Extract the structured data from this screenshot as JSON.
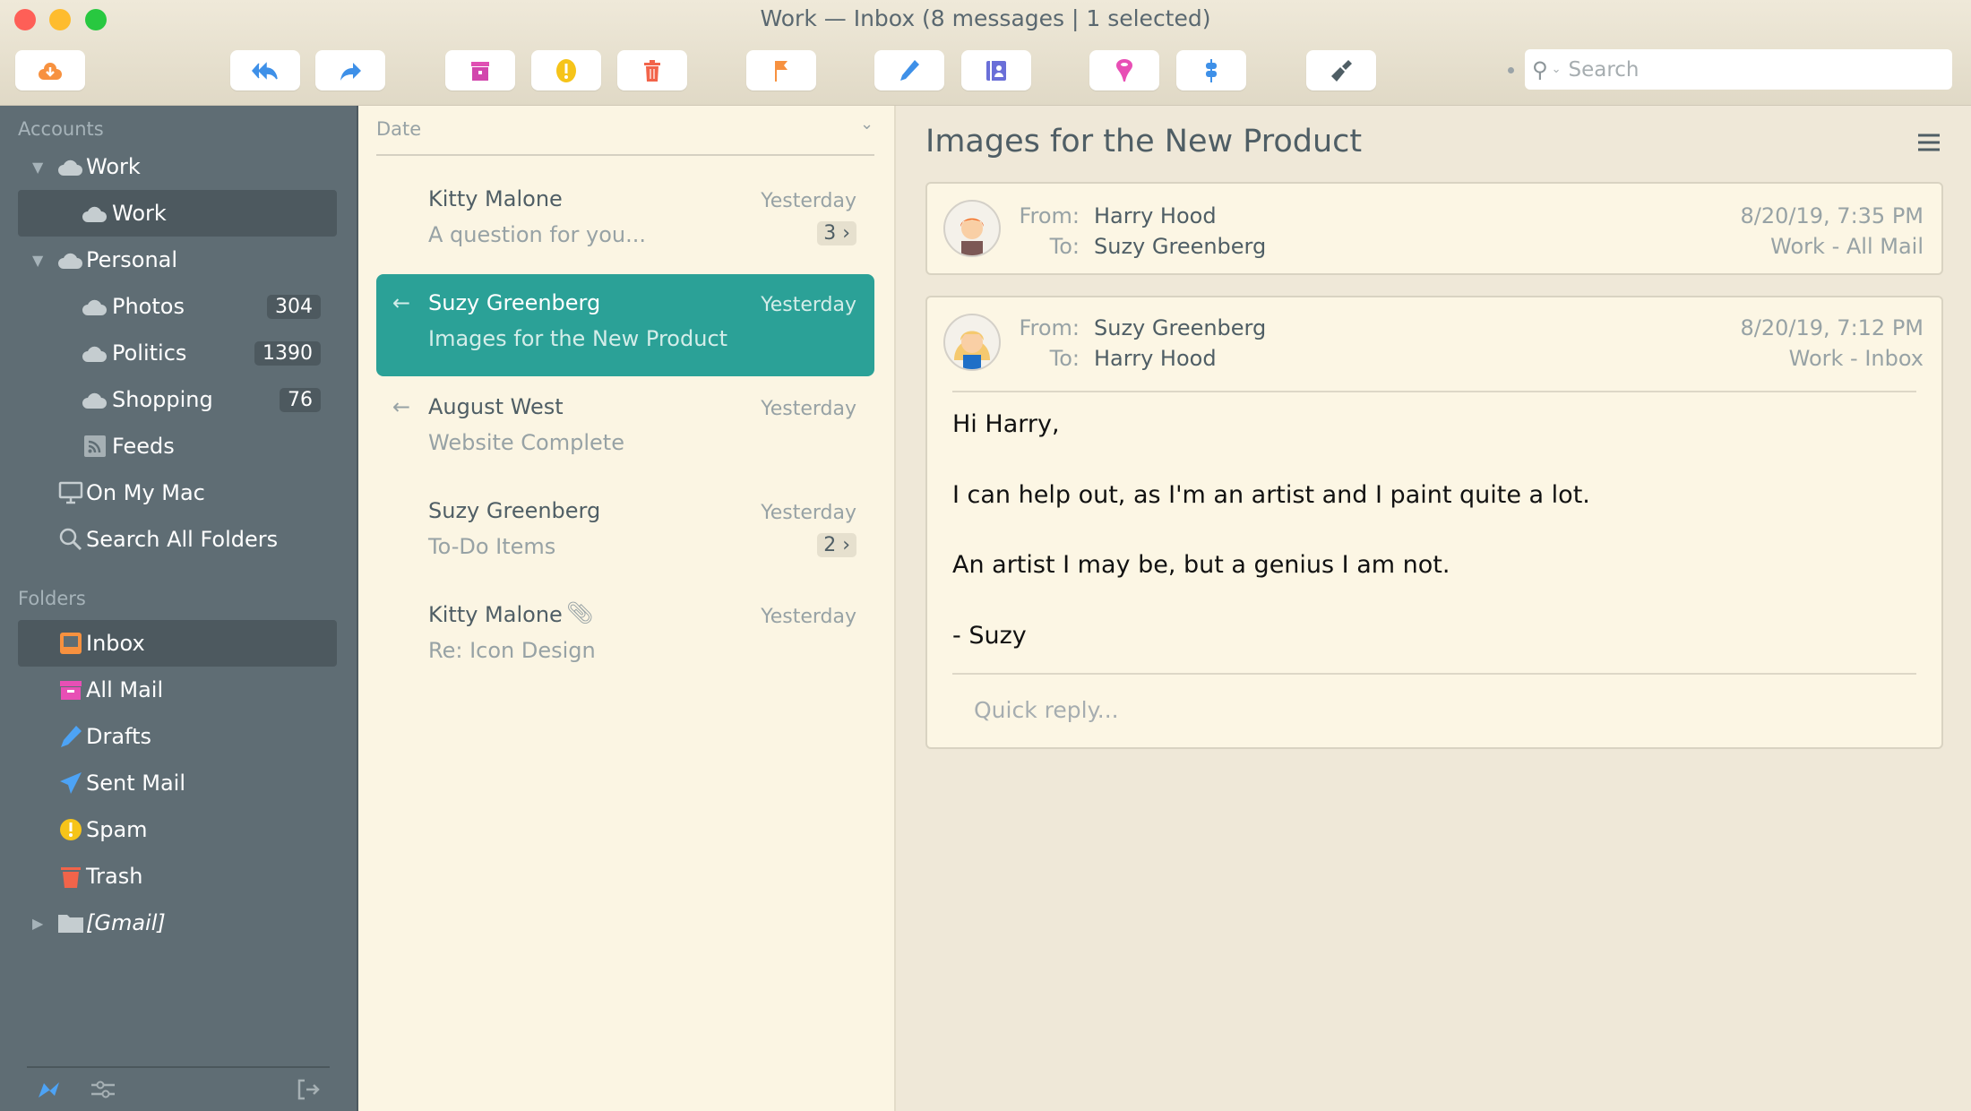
{
  "window": {
    "title": "Work — Inbox (8 messages | 1 selected)"
  },
  "toolbar": {
    "buttons": [
      "get-mail",
      "reply-all",
      "forward",
      "archive",
      "spam",
      "delete",
      "flag",
      "compose",
      "contacts",
      "filter",
      "rules",
      "theme"
    ],
    "search_placeholder": "Search"
  },
  "sidebar": {
    "accounts_header": "Accounts",
    "accounts": [
      {
        "label": "Work",
        "type": "account"
      },
      {
        "label": "Work",
        "type": "sub",
        "selected": true
      },
      {
        "label": "Personal",
        "type": "account"
      },
      {
        "label": "Photos",
        "type": "sub",
        "badge": "304"
      },
      {
        "label": "Politics",
        "type": "sub",
        "badge": "1390"
      },
      {
        "label": "Shopping",
        "type": "sub",
        "badge": "76"
      },
      {
        "label": "Feeds",
        "type": "sub"
      },
      {
        "label": "On My Mac",
        "type": "top"
      },
      {
        "label": "Search All Folders",
        "type": "top"
      }
    ],
    "folders_header": "Folders",
    "folders": [
      {
        "label": "Inbox",
        "selected": true
      },
      {
        "label": "All Mail"
      },
      {
        "label": "Drafts"
      },
      {
        "label": "Sent Mail"
      },
      {
        "label": "Spam"
      },
      {
        "label": "Trash"
      },
      {
        "label": "[Gmail]"
      }
    ]
  },
  "list": {
    "sort_label": "Date",
    "messages": [
      {
        "from": "Kitty Malone",
        "subject": "A question for you...",
        "date": "Yesterday",
        "count": "3 ›"
      },
      {
        "from": "Suzy Greenberg",
        "subject": "Images for the New Product",
        "date": "Yesterday",
        "replied": true,
        "selected": true
      },
      {
        "from": "August West",
        "subject": "Website Complete",
        "date": "Yesterday",
        "replied": true
      },
      {
        "from": "Suzy Greenberg",
        "subject": "To-Do Items",
        "date": "Yesterday",
        "count": "2 ›"
      },
      {
        "from": "Kitty Malone",
        "subject": "Re: Icon Design",
        "date": "Yesterday",
        "attachment": true
      }
    ]
  },
  "reader": {
    "subject": "Images for the New Product",
    "from_label": "From:",
    "to_label": "To:",
    "messages": [
      {
        "from": "Harry Hood",
        "to": "Suzy Greenberg",
        "date": "8/20/19, 7:35 PM",
        "folder": "Work - All Mail"
      },
      {
        "from": "Suzy Greenberg",
        "to": "Harry Hood",
        "date": "8/20/19, 7:12 PM",
        "folder": "Work - Inbox",
        "body": [
          "Hi Harry,",
          "I can help out, as I'm an artist and I paint quite a lot.",
          "An artist I may be, but a genius I am not.",
          "- Suzy"
        ]
      }
    ],
    "quick_reply_placeholder": "Quick reply..."
  },
  "colors": {
    "accent": "#2ba197",
    "sidebar": "#5f6d74"
  }
}
